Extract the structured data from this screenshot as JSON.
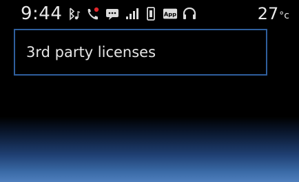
{
  "status_bar": {
    "time": "9:44",
    "temperature_value": "27",
    "temperature_unit": "°c",
    "icons": [
      "bluetooth-audio-icon",
      "phone-missed-call-icon",
      "message-icon",
      "signal-strength-icon",
      "phone-battery-icon",
      "app-icon",
      "headset-icon"
    ],
    "app_icon_label": "App"
  },
  "menu": {
    "items": [
      {
        "label": "3rd party licenses"
      }
    ]
  },
  "colors": {
    "accent": "#2f5f9e",
    "notification_red": "#e0262b",
    "text": "#e9e9e9",
    "background": "#000000"
  }
}
